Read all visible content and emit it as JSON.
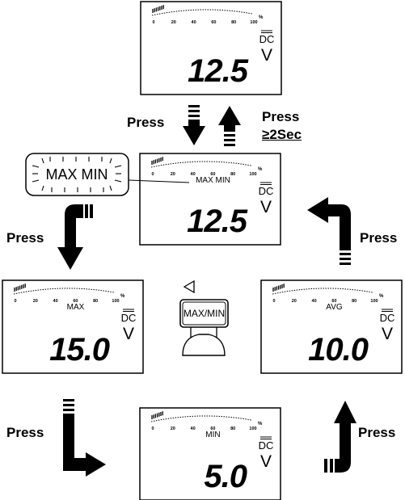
{
  "displays": {
    "top": {
      "mode_label": "",
      "reading": "12.5",
      "coupling": "DC",
      "unit": "V"
    },
    "center": {
      "mode_label": "MAX MIN",
      "reading": "12.5",
      "coupling": "DC",
      "unit": "V"
    },
    "left": {
      "mode_label": "MAX",
      "reading": "15.0",
      "coupling": "DC",
      "unit": "V"
    },
    "right": {
      "mode_label": "AVG",
      "reading": "10.0",
      "coupling": "DC",
      "unit": "V"
    },
    "bottom": {
      "mode_label": "MIN",
      "reading": "5.0",
      "coupling": "DC",
      "unit": "V"
    }
  },
  "bargraph_ticks": [
    "0",
    "20",
    "40",
    "60",
    "80",
    "100",
    "%"
  ],
  "callout_label": "MAX MIN",
  "button_label": "MAX/MIN",
  "labels": {
    "press": "Press",
    "press_hold": "≥2Sec"
  }
}
